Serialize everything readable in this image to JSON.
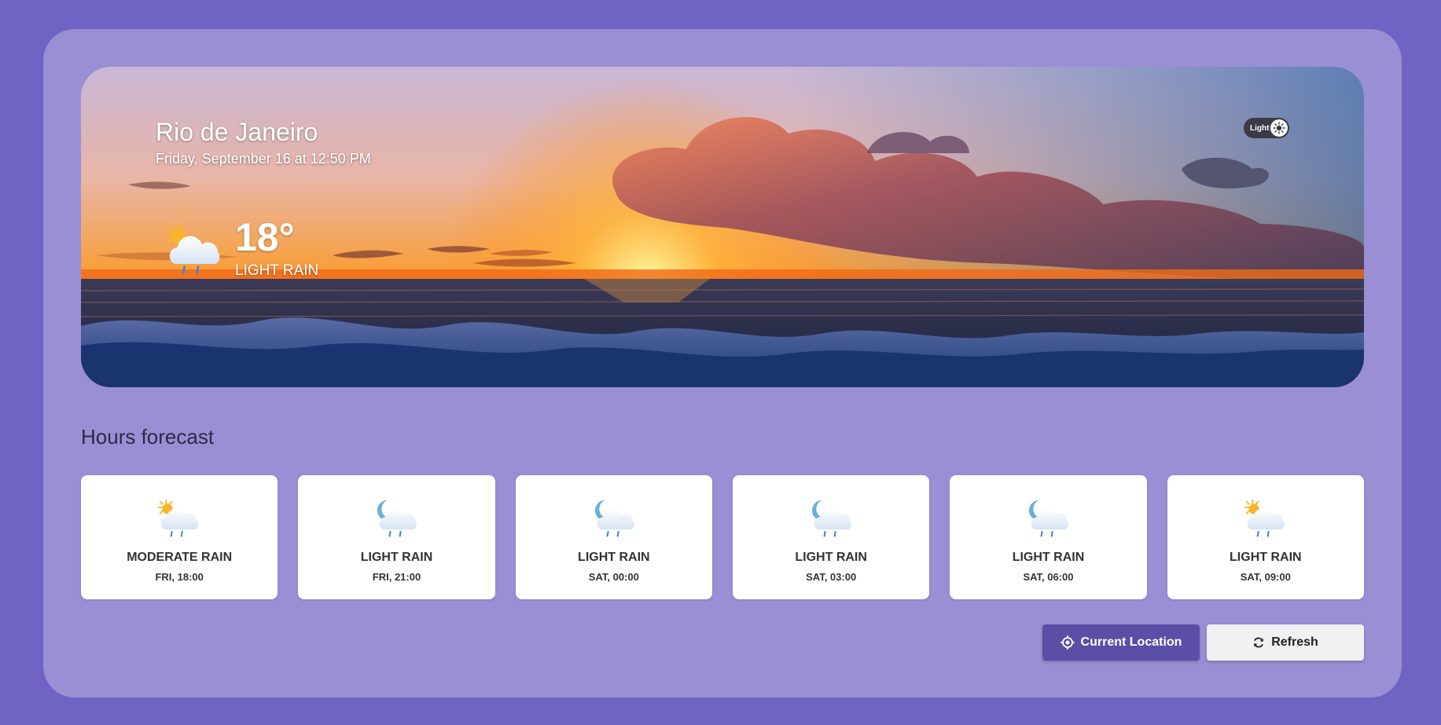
{
  "location": {
    "city": "Rio de Janeiro",
    "datetime": "Friday, September 16 at 12:50 PM"
  },
  "current": {
    "temperature": "18°",
    "condition": "LIGHT RAIN",
    "icon": "sun-cloud-rain-icon"
  },
  "theme_toggle": {
    "label": "Light",
    "icon": "sun-icon"
  },
  "forecast": {
    "title": "Hours forecast",
    "items": [
      {
        "condition": "MODERATE RAIN",
        "time": "FRI, 18:00",
        "icon": "sun-cloud-rain-icon"
      },
      {
        "condition": "LIGHT RAIN",
        "time": "FRI, 21:00",
        "icon": "moon-cloud-rain-icon"
      },
      {
        "condition": "LIGHT RAIN",
        "time": "SAT, 00:00",
        "icon": "moon-cloud-rain-icon"
      },
      {
        "condition": "LIGHT RAIN",
        "time": "SAT, 03:00",
        "icon": "moon-cloud-rain-icon"
      },
      {
        "condition": "LIGHT RAIN",
        "time": "SAT, 06:00",
        "icon": "moon-cloud-rain-icon"
      },
      {
        "condition": "LIGHT RAIN",
        "time": "SAT, 09:00",
        "icon": "sun-cloud-rain-icon"
      }
    ]
  },
  "buttons": {
    "current_location": "Current Location",
    "refresh": "Refresh"
  },
  "colors": {
    "page_bg": "#6f63c4",
    "card_bg": "#9a8fd4",
    "primary_button": "#5b4ea6"
  }
}
